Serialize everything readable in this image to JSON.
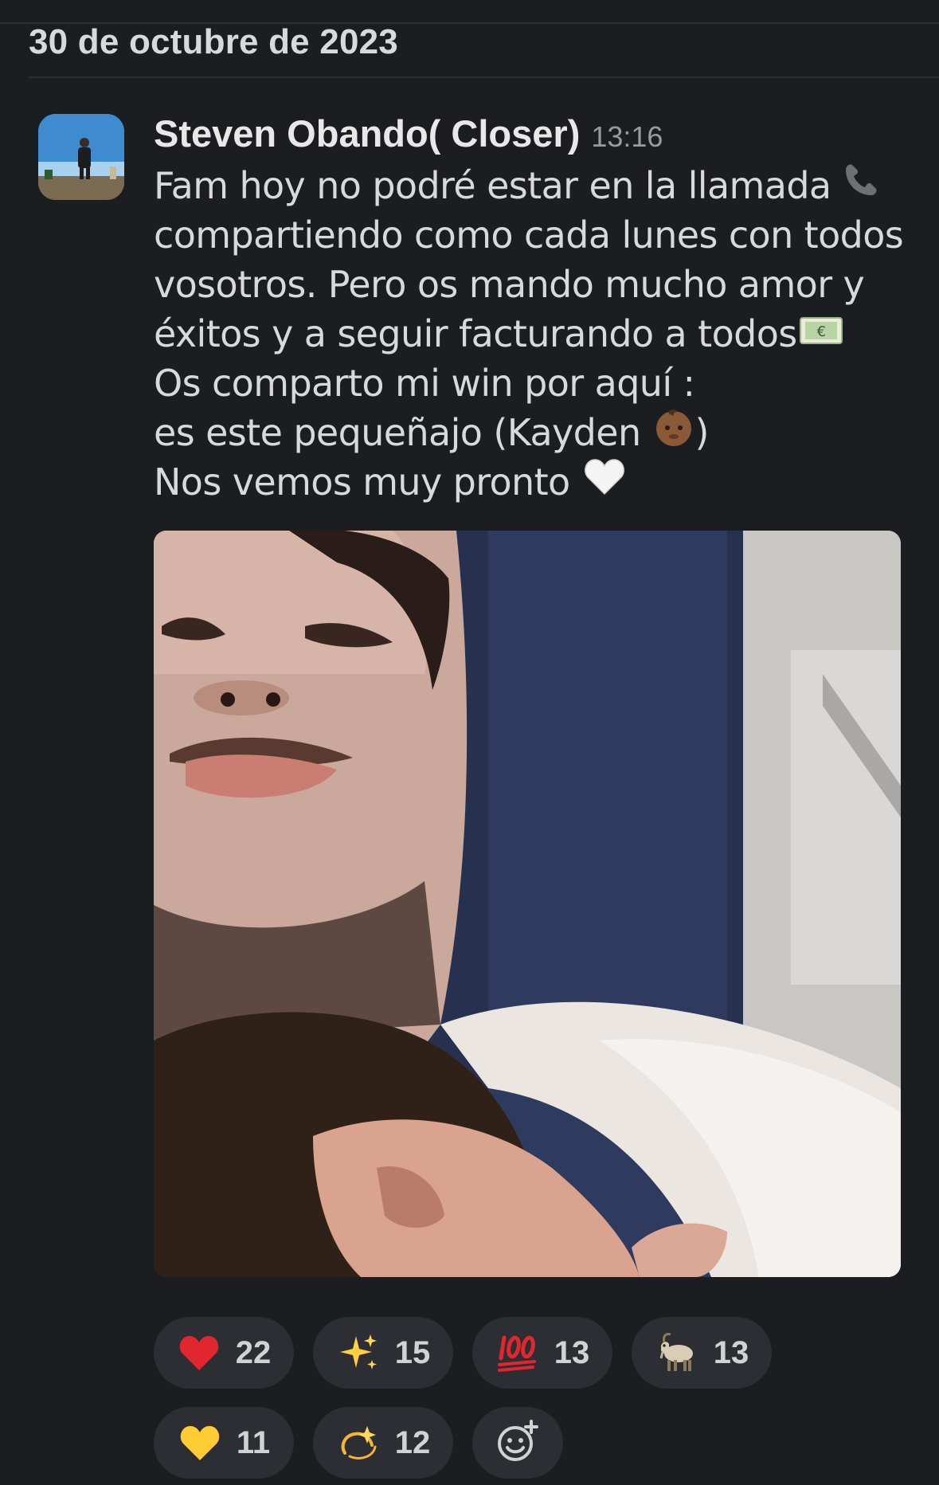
{
  "date_header": "30 de octubre de 2023",
  "message": {
    "author": "Steven Obando( Closer)",
    "time": "13:16",
    "lines": [
      {
        "text": "Fam hoy no podré estar en la llamada",
        "emoji": "telephone-receiver-icon"
      },
      {
        "text": "compartiendo como cada lunes con todos",
        "emoji": ""
      },
      {
        "text": "vosotros. Pero os mando mucho amor y",
        "emoji": ""
      },
      {
        "text": "éxitos y a seguir facturando a todos",
        "emoji": "euro-banknote-icon"
      },
      {
        "text": "Os comparto mi win por aquí :",
        "emoji": ""
      },
      {
        "text": "es este pequeñajo (Kayden",
        "emoji": "baby-icon",
        "after": ")"
      },
      {
        "text": "Nos vemos muy pronto",
        "emoji": "white-heart-icon"
      }
    ],
    "attachment": {
      "type": "photo"
    }
  },
  "reactions": [
    {
      "emoji": "red-heart-icon",
      "count": "22"
    },
    {
      "emoji": "sparkles-icon",
      "count": "15"
    },
    {
      "emoji": "hundred-points-icon",
      "count": "13"
    },
    {
      "emoji": "goat-icon",
      "count": "13"
    },
    {
      "emoji": "yellow-heart-icon",
      "count": "11"
    },
    {
      "emoji": "dizzy-icon",
      "count": "12"
    }
  ],
  "add_reaction": {
    "icon": "add-reaction-icon"
  },
  "colors": {
    "background": "#1b1d21",
    "text": "#d8d9da",
    "muted": "#9a9b9d",
    "pill": "#2c2e33"
  }
}
